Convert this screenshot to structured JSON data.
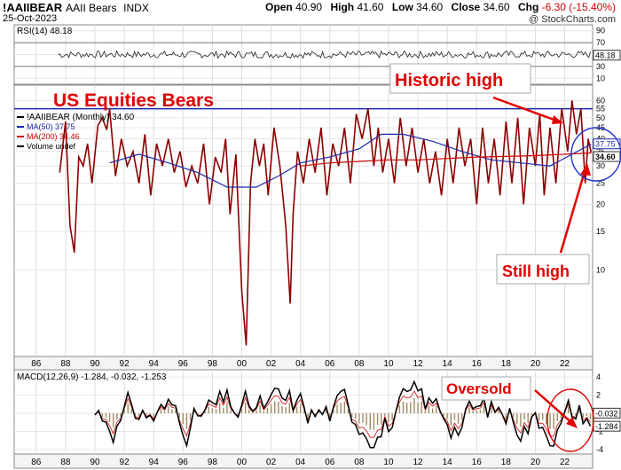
{
  "header": {
    "symbol": "!AAIIBEAR",
    "name": "AAII Bears",
    "exchange": "INDX",
    "date": "25-Oct-2023",
    "watermark": "@ StockCharts.com",
    "open_label": "Open",
    "open": "40.90",
    "high_label": "High",
    "high": "41.60",
    "low_label": "Low",
    "low": "34.60",
    "close_label": "Close",
    "close": "34.60",
    "chg_label": "Chg",
    "chg": "-6.30 (-15.40%)"
  },
  "annotations": {
    "title": "US Equities Bears",
    "historic_high": "Historic high",
    "still_high": "Still high",
    "oversold": "Oversold"
  },
  "colors": {
    "price": "#8b0000",
    "ma50": "#1a2aa8",
    "ma200": "#cc0000",
    "annotation": "#e00000",
    "hline": "#1a2aa8"
  },
  "chart_data": [
    {
      "type": "line",
      "panel": "rsi",
      "legend": "RSI(14) 48.18",
      "last_value_label": "48.18",
      "yticks": [
        10,
        30,
        50,
        70,
        90
      ],
      "ylim": [
        0,
        100
      ],
      "reference_lines": [
        30,
        70
      ]
    },
    {
      "type": "line",
      "panel": "price",
      "legend": [
        "!AAIIBEAR (Monthly) 34.60",
        "MA(50) 37.75",
        "MA(200) 34.46",
        "Volume undef"
      ],
      "scale": "log",
      "yticks": [
        10,
        15,
        20,
        25,
        30,
        35,
        40,
        45,
        50,
        55,
        60
      ],
      "ylim": [
        4,
        68
      ],
      "last_value_labels": [
        "37.75",
        "34.60"
      ],
      "horizontal_line": 55,
      "x_range": [
        1987.5,
        2023.8
      ],
      "xticks": [
        "86",
        "88",
        "90",
        "92",
        "94",
        "96",
        "98",
        "00",
        "02",
        "04",
        "06",
        "08",
        "10",
        "12",
        "14",
        "16",
        "18",
        "20",
        "22"
      ],
      "series": [
        {
          "name": "!AAIIBEAR",
          "x": [
            1987.6,
            1988.0,
            1988.3,
            1988.6,
            1988.9,
            1989.2,
            1989.5,
            1989.8,
            1990.2,
            1990.5,
            1990.8,
            1991.0,
            1991.4,
            1991.8,
            1992.2,
            1992.6,
            1993.0,
            1993.4,
            1993.8,
            1994.2,
            1994.6,
            1995.0,
            1995.4,
            1995.8,
            1996.2,
            1996.6,
            1997.0,
            1997.4,
            1997.8,
            1998.2,
            1998.6,
            1998.9,
            1999.2,
            1999.6,
            2000.0,
            2000.3,
            2000.6,
            2000.9,
            2001.2,
            2001.5,
            2001.8,
            2002.2,
            2002.6,
            2003.0,
            2003.3,
            2003.5,
            2003.8,
            2004.2,
            2004.6,
            2005.0,
            2005.4,
            2005.8,
            2006.2,
            2006.6,
            2007.0,
            2007.4,
            2007.8,
            2008.2,
            2008.6,
            2009.0,
            2009.3,
            2009.6,
            2010.0,
            2010.4,
            2010.8,
            2011.2,
            2011.6,
            2012.0,
            2012.4,
            2012.8,
            2013.2,
            2013.6,
            2014.0,
            2014.4,
            2014.8,
            2015.2,
            2015.6,
            2016.0,
            2016.4,
            2016.8,
            2017.2,
            2017.6,
            2018.0,
            2018.4,
            2018.8,
            2019.2,
            2019.6,
            2020.0,
            2020.3,
            2020.6,
            2021.0,
            2021.4,
            2021.8,
            2022.2,
            2022.5,
            2022.8,
            2023.1,
            2023.4,
            2023.6,
            2023.8
          ],
          "values": [
            28,
            48,
            16,
            12,
            33,
            30,
            38,
            25,
            46,
            50,
            44,
            55,
            27,
            40,
            30,
            35,
            25,
            42,
            22,
            38,
            30,
            40,
            28,
            35,
            24,
            30,
            25,
            38,
            20,
            33,
            28,
            40,
            18,
            34,
            8,
            4.5,
            25,
            40,
            30,
            38,
            22,
            45,
            30,
            16,
            7,
            18,
            35,
            25,
            40,
            28,
            45,
            22,
            38,
            30,
            45,
            25,
            52,
            40,
            55,
            30,
            45,
            28,
            40,
            25,
            50,
            30,
            45,
            28,
            40,
            25,
            35,
            22,
            40,
            25,
            45,
            30,
            40,
            20,
            45,
            25,
            40,
            22,
            48,
            25,
            50,
            20,
            45,
            30,
            52,
            22,
            45,
            25,
            55,
            35,
            60,
            42,
            55,
            25,
            40,
            34.6
          ]
        },
        {
          "name": "MA(50)",
          "x": [
            1991.0,
            1993.0,
            1995.0,
            1997.0,
            1999.0,
            2001.0,
            2002.5,
            2004.0,
            2006.0,
            2008.0,
            2009.5,
            2011.0,
            2013.0,
            2015.0,
            2017.0,
            2019.0,
            2021.0,
            2022.5,
            2023.8
          ],
          "values": [
            31,
            34,
            31,
            28,
            24,
            24,
            27,
            31,
            33,
            36,
            42,
            42,
            39,
            35,
            32,
            31,
            30,
            34,
            37.75
          ]
        },
        {
          "name": "MA(200)",
          "x": [
            2004.0,
            2006.0,
            2008.0,
            2010.0,
            2012.0,
            2014.0,
            2016.0,
            2018.0,
            2020.0,
            2022.0,
            2023.8
          ],
          "values": [
            30,
            31,
            31.5,
            32,
            32,
            32.5,
            33,
            33.2,
            33.5,
            34,
            34.46
          ]
        }
      ]
    },
    {
      "type": "line",
      "panel": "macd",
      "legend": "MACD(12,26,9) -1.284, -0.032, -1.253",
      "yticks": [
        -4,
        -2,
        0,
        2,
        4
      ],
      "ylim": [
        -4.5,
        4.8
      ],
      "last_value_labels": [
        "-0.032",
        "-1.284"
      ],
      "xticks": [
        "86",
        "88",
        "90",
        "92",
        "94",
        "96",
        "98",
        "00",
        "02",
        "04",
        "06",
        "08",
        "10",
        "12",
        "14",
        "16",
        "18",
        "20",
        "22"
      ]
    }
  ]
}
